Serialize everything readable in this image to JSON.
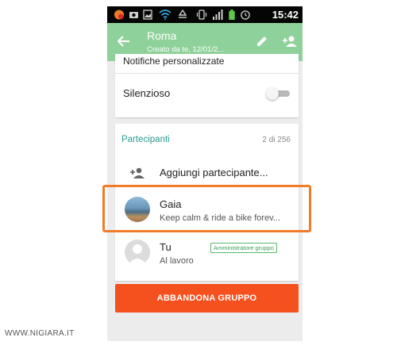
{
  "status_bar": {
    "time": "15:42",
    "icons": [
      "app-notification-icon",
      "camera-icon",
      "wifi-icon",
      "recycle-icon",
      "vibrate-icon",
      "signal-icon",
      "battery-icon",
      "alarm-icon"
    ]
  },
  "action_bar": {
    "title": "Roma",
    "subtitle": "Creato da te, 12/01/2..."
  },
  "settings_card": {
    "notifications_label": "Notifiche personalizzate",
    "silent_label": "Silenzioso",
    "silent_enabled": false
  },
  "participants": {
    "header": "Partecipanti",
    "count": "2 di 256",
    "add_label": "Aggiungi partecipante...",
    "items": [
      {
        "name": "Gaia",
        "status": "Keep calm & ride a bike forev..."
      },
      {
        "name": "Tu",
        "status": "Al lavoro",
        "badge": "Amministratore gruppo"
      }
    ]
  },
  "leave_button": "ABBANDONA GRUPPO",
  "watermark": "WWW.NIGIARA.IT",
  "colors": {
    "action_bar": "#8fd19a",
    "accent_text": "#2a9d8f",
    "leave_button": "#f4511e",
    "highlight": "#f07c2a",
    "badge": "#54b86a"
  }
}
